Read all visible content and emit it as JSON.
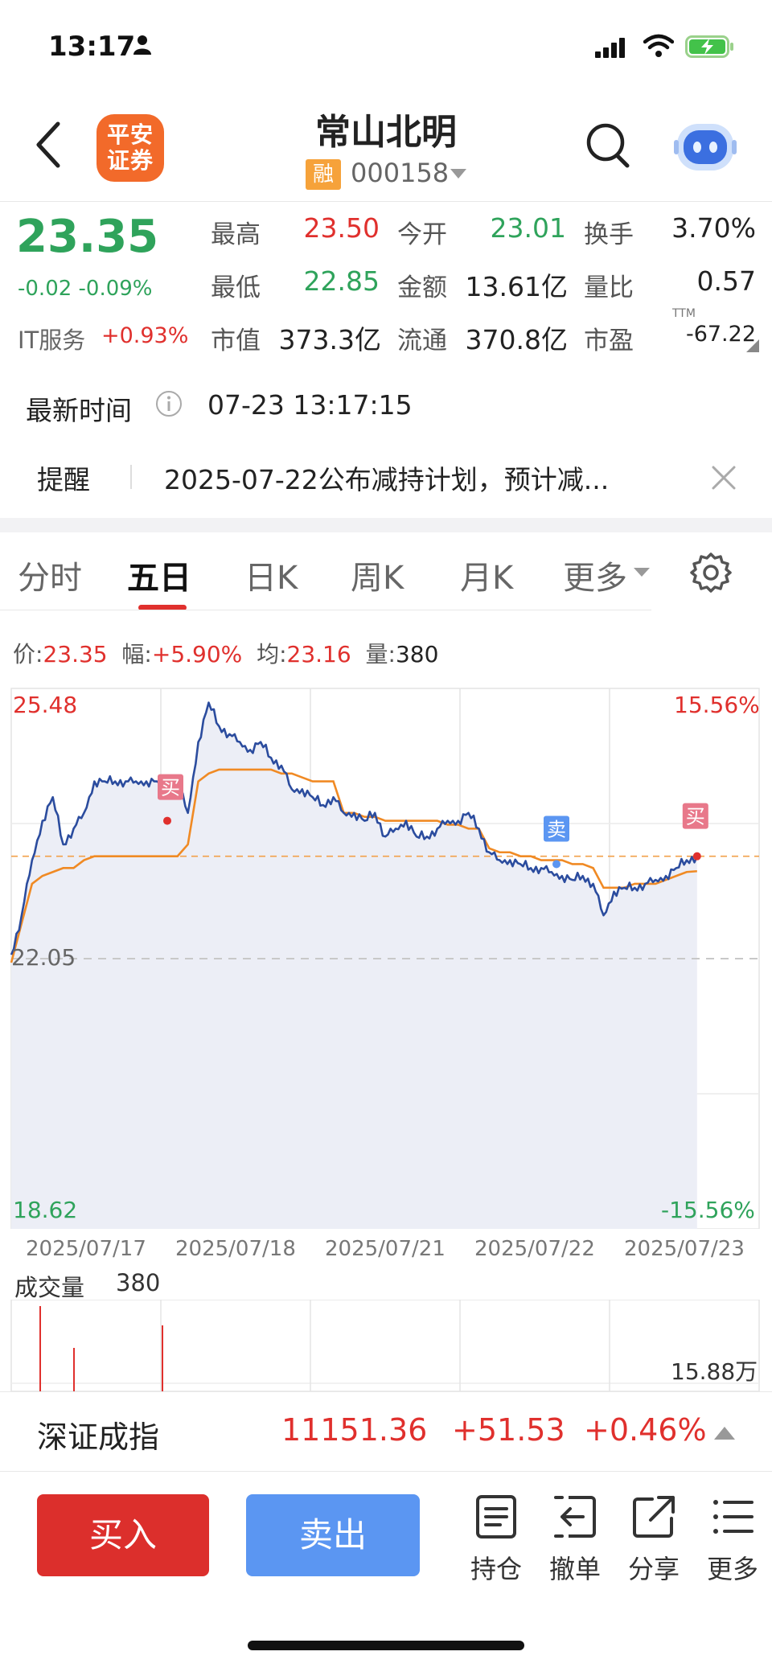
{
  "status_bar": {
    "time": "13:17"
  },
  "header": {
    "broker_logo_text": "平安\n证券",
    "stock_name": "常山北明",
    "margin_badge": "融",
    "stock_code": "000158"
  },
  "quote": {
    "last_price": "23.35",
    "change": "-0.02 -0.09%",
    "sector": {
      "name": "IT服务",
      "change": "+0.93%"
    },
    "fields": {
      "high": {
        "label": "最高",
        "value": "23.50"
      },
      "open": {
        "label": "今开",
        "value": "23.01"
      },
      "turnover": {
        "label": "换手",
        "value": "3.70%"
      },
      "low": {
        "label": "最低",
        "value": "22.85"
      },
      "amount": {
        "label": "金额",
        "value": "13.61亿"
      },
      "volume_ratio": {
        "label": "量比",
        "value": "0.57"
      },
      "market_cap": {
        "label": "市值",
        "value": "373.3亿"
      },
      "float_cap": {
        "label": "流通",
        "value": "370.8亿"
      },
      "pe": {
        "label": "市盈",
        "value": "-67.22",
        "sup": "TTM"
      }
    },
    "latest_time": {
      "label": "最新时间",
      "value": "07-23 13:17:15"
    },
    "reminder": {
      "label": "提醒",
      "text": "2025-07-22公布减持计划，预计减..."
    }
  },
  "tabs": [
    "分时",
    "五日",
    "日K",
    "周K",
    "月K",
    "更多"
  ],
  "active_tab": "五日",
  "chart_info": {
    "price_label": "价:",
    "price": "23.35",
    "range_label": "幅:",
    "range": "+5.90%",
    "avg_label": "均:",
    "avg": "23.16",
    "vol_label": "量:",
    "vol": "380"
  },
  "chart_data": {
    "type": "line",
    "title": "",
    "x": [
      "2025/07/17",
      "2025/07/18",
      "2025/07/21",
      "2025/07/22",
      "2025/07/23"
    ],
    "y_axis_left": {
      "max": "25.48",
      "mid": "22.05",
      "min": "18.62"
    },
    "y_axis_right": {
      "max": "15.56%",
      "min": "-15.56%"
    },
    "ylim": [
      18.62,
      25.48
    ],
    "reference_price": 22.05,
    "series": [
      {
        "values": [
          22.1,
          22.6,
          23.3,
          23.8,
          24.1,
          23.5,
          23.7,
          23.9,
          24.3,
          24.3,
          24.3,
          24.3,
          24.3,
          24.3,
          24.3,
          24.3,
          24.3,
          23.9,
          24.8,
          25.3,
          25.0,
          24.9,
          24.8,
          24.7,
          24.8,
          24.6,
          24.5,
          24.2,
          24.2,
          24.1,
          24.0,
          24.1,
          23.9,
          23.9,
          23.8,
          23.9,
          23.6,
          23.7,
          23.8,
          23.6,
          23.6,
          23.7,
          23.8,
          23.8,
          23.9,
          23.7,
          23.4,
          23.3,
          23.3,
          23.25,
          23.2,
          23.2,
          23.15,
          23.1,
          23.05,
          23.1,
          23.0,
          22.6,
          22.9,
          22.95,
          22.95,
          23.0,
          23.05,
          23.1,
          23.2,
          23.3,
          23.35
        ]
      },
      {
        "values": [
          22.0,
          22.5,
          23.0,
          23.1,
          23.15,
          23.2,
          23.2,
          23.3,
          23.35,
          23.35,
          23.35,
          23.35,
          23.35,
          23.35,
          23.35,
          23.35,
          23.35,
          23.5,
          24.3,
          24.4,
          24.45,
          24.45,
          24.45,
          24.45,
          24.45,
          24.45,
          24.4,
          24.4,
          24.35,
          24.3,
          24.3,
          24.3,
          23.9,
          23.9,
          23.85,
          23.85,
          23.8,
          23.8,
          23.8,
          23.8,
          23.8,
          23.8,
          23.75,
          23.75,
          23.7,
          23.7,
          23.45,
          23.4,
          23.4,
          23.35,
          23.35,
          23.3,
          23.3,
          23.3,
          23.25,
          23.25,
          23.2,
          22.95,
          22.95,
          22.95,
          23.0,
          23.0,
          23.0,
          23.05,
          23.1,
          23.15,
          23.16
        ]
      }
    ],
    "markers": [
      {
        "label": "买",
        "date": "2025/07/18",
        "type": "buy"
      },
      {
        "label": "卖",
        "date": "2025/07/22",
        "type": "sell"
      },
      {
        "label": "买",
        "date": "2025/07/23",
        "type": "buy"
      }
    ]
  },
  "volume": {
    "label": "成交量",
    "value": "380",
    "max_label": "15.88万"
  },
  "index_bar": {
    "name": "深证成指",
    "value": "11151.36",
    "change": "+51.53",
    "pct": "+0.46%"
  },
  "actions": {
    "buy": "买入",
    "sell": "卖出",
    "items": [
      {
        "label": "持仓",
        "icon": "position-icon"
      },
      {
        "label": "撤单",
        "icon": "cancel-order-icon"
      },
      {
        "label": "分享",
        "icon": "share-icon"
      },
      {
        "label": "更多",
        "icon": "menu-icon"
      }
    ]
  }
}
